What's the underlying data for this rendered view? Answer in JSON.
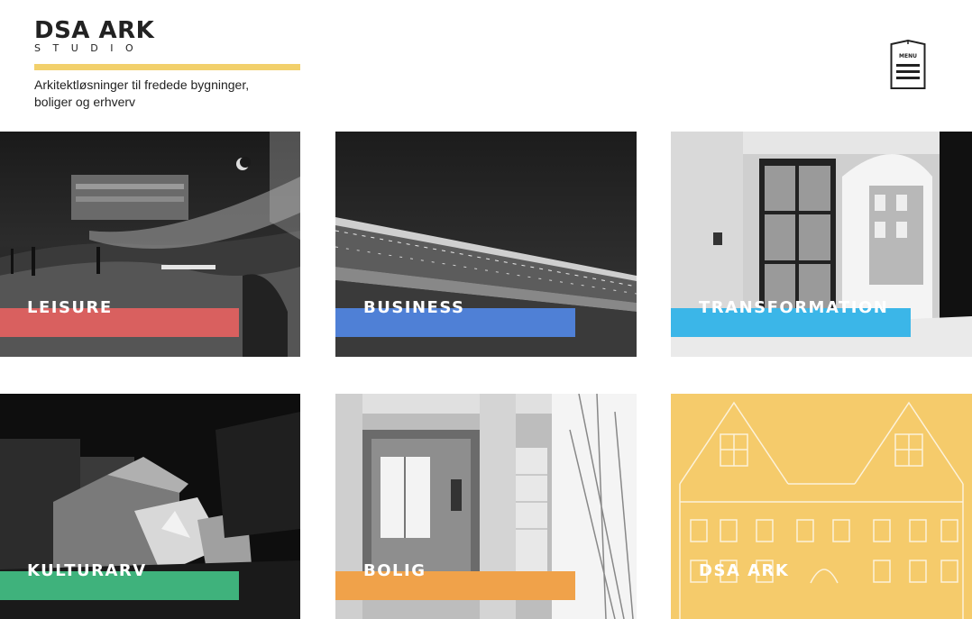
{
  "brand": {
    "name": "DSA ARK",
    "sub": "STUDIO",
    "tagline_line1": "Arkitektløsninger til fredede bygninger,",
    "tagline_line2": "boliger og erhverv",
    "accent": "#F2D06B"
  },
  "menu": {
    "label": "MENU",
    "icon": "menu-book-icon"
  },
  "tiles": [
    {
      "label": "LEISURE",
      "band_color": "#D9605F",
      "image": "night-plaza-photo"
    },
    {
      "label": "BUSINESS",
      "band_color": "#4F80D6",
      "image": "train-station-night-photo"
    },
    {
      "label": "TRANSFORMATION",
      "band_color": "#3BB6E8",
      "image": "interior-window-photo"
    },
    {
      "label": "KULTURARV",
      "band_color": "#3FB27C",
      "image": "illuminated-house-photo"
    },
    {
      "label": "BOLIG",
      "band_color": "#F0A24A",
      "image": "interior-doorway-photo"
    },
    {
      "label": "DSA ARK",
      "band_color": "#F7CD6C",
      "image": "facade-line-drawing"
    }
  ]
}
